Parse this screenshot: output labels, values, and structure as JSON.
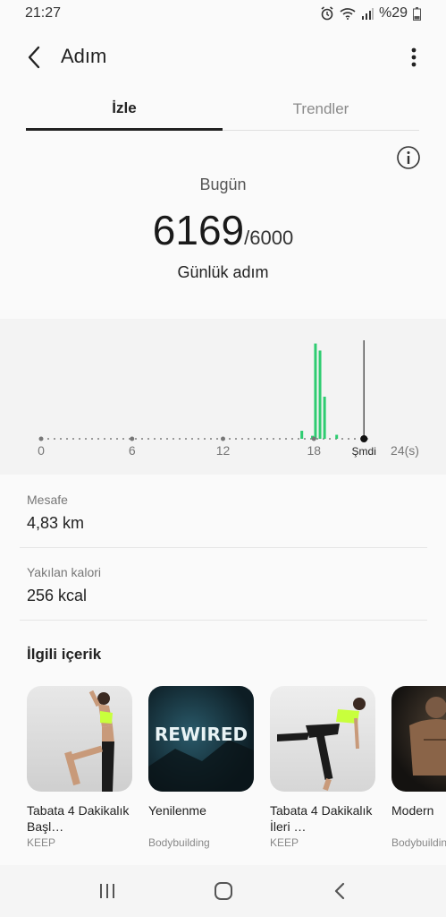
{
  "status_bar": {
    "time": "21:27",
    "battery": "%29"
  },
  "header": {
    "title": "Adım"
  },
  "tabs": [
    {
      "label": "İzle"
    },
    {
      "label": "Trendler"
    }
  ],
  "summary": {
    "today_label": "Bugün",
    "steps": "6169",
    "goal": "/6000",
    "daily_label": "Günlük adım"
  },
  "chart_data": {
    "type": "bar",
    "x_ticks": [
      "0",
      "6",
      "12",
      "18",
      "Şmdi",
      "24(s)"
    ],
    "now_hour": 21.3,
    "bars": [
      {
        "hour": 17.2,
        "value": 8
      },
      {
        "hour": 17.9,
        "value": 3
      },
      {
        "hour": 18.1,
        "value": 95
      },
      {
        "hour": 18.4,
        "value": 88
      },
      {
        "hour": 18.7,
        "value": 42
      },
      {
        "hour": 19.5,
        "value": 4
      }
    ],
    "ymax": 100,
    "accent": "#2ecc71"
  },
  "metrics": [
    {
      "label": "Mesafe",
      "value": "4,83 km"
    },
    {
      "label": "Yakılan kalori",
      "value": "256 kcal"
    }
  ],
  "related": {
    "title": "İlgili içerik",
    "items": [
      {
        "title": "Tabata 4 Dakikalık Başl…",
        "subtitle": "KEEP"
      },
      {
        "title": "Yenilenme",
        "subtitle": "Bodybuilding",
        "badge": "REWIRED"
      },
      {
        "title": "Tabata 4 Dakikalık İleri …",
        "subtitle": "KEEP"
      },
      {
        "title": "Modern",
        "subtitle": "Bodybuilding"
      }
    ]
  }
}
